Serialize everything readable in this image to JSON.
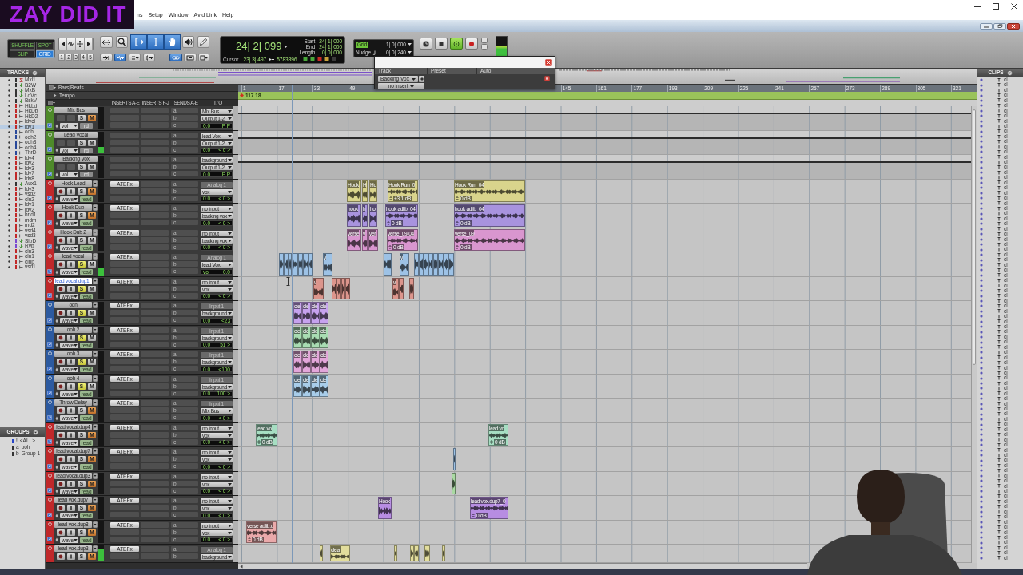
{
  "logo": {
    "text": "ZAY DID IT"
  },
  "menu": [
    {
      "label": "ns"
    },
    {
      "label": "Setup"
    },
    {
      "label": "Window"
    },
    {
      "label": "Avid Link"
    },
    {
      "label": "Help"
    }
  ],
  "toolbar": {
    "edit_modes": [
      {
        "label": "SHUFFLE",
        "selected": false
      },
      {
        "label": "SPOT",
        "selected": false
      },
      {
        "label": "SLIP",
        "selected": false
      },
      {
        "label": "GRID",
        "selected": true
      }
    ],
    "zoom_presets": [
      "1",
      "2",
      "3",
      "4",
      "5"
    ],
    "tools": [
      {
        "kind": "zoom-toggle",
        "selected": false
      },
      {
        "kind": "zoomer",
        "selected": false
      },
      {
        "kind": "trim",
        "selected": true
      },
      {
        "kind": "selector",
        "selected": true
      },
      {
        "kind": "grabber",
        "selected": true
      },
      {
        "kind": "scrub",
        "selected": false
      },
      {
        "kind": "pencil",
        "selected": false
      }
    ],
    "options": [
      {
        "kind": "arrow-bar",
        "selected": false
      },
      {
        "kind": "wave-arrow",
        "selected": true
      },
      {
        "kind": "lines-arrow",
        "selected": false
      },
      {
        "kind": "bracket-arrow",
        "selected": false
      },
      {
        "kind": "link",
        "selected": true
      },
      {
        "kind": "link-box",
        "selected": false
      },
      {
        "kind": "box-arrow",
        "selected": false
      }
    ],
    "counter": {
      "main": "24| 2| 099",
      "start_label": "Start",
      "start": "24| 1| 000",
      "end_label": "End",
      "end": "24| 1| 000",
      "length_label": "Length",
      "length": "0| 0| 000",
      "cursor_label": "Cursor",
      "cursor": "23| 3| 497",
      "sample": "5783896"
    },
    "indicators": [
      {
        "color": "#49a83a"
      },
      {
        "color": "#49a83a"
      },
      {
        "color": "#c92a24"
      },
      {
        "color": "#c9a23a"
      },
      {
        "color": "#3a3a3a"
      }
    ],
    "grid": {
      "label": "Grid",
      "on": true,
      "value": "1| 0| 000"
    },
    "nudge": {
      "label": "Nudge",
      "value": "0| 0| 240"
    },
    "transport": [
      {
        "kind": "online",
        "on": false
      },
      {
        "kind": "stop",
        "on": false
      },
      {
        "kind": "loop-play",
        "on": true
      },
      {
        "kind": "record",
        "on": false
      },
      {
        "kind": "mini",
        "on": false
      },
      {
        "kind": "mini",
        "on": false
      }
    ],
    "meter": {
      "level": 0.55
    }
  },
  "popup": {
    "columns": [
      {
        "label": "Track"
      },
      {
        "label": "Preset"
      },
      {
        "label": "Auto"
      }
    ],
    "track": "Backing Vox",
    "insert": "no insert"
  },
  "tracks_panel": {
    "title": "TRACKS",
    "items": [
      {
        "name": "Mxl1",
        "kind": "master",
        "color": "#333333",
        "selected": false
      },
      {
        "name": "B2W",
        "kind": "aux",
        "color": "#333333",
        "selected": false
      },
      {
        "name": "MxB",
        "kind": "aux",
        "color": "#333333",
        "selected": false
      },
      {
        "name": "LdVc",
        "kind": "aux",
        "color": "#333333",
        "selected": false
      },
      {
        "name": "BskV",
        "kind": "aux",
        "color": "#333333",
        "selected": false
      },
      {
        "name": "HkLd",
        "kind": "audio",
        "color": "#c02828",
        "selected": false
      },
      {
        "name": "HkDb",
        "kind": "audio",
        "color": "#c02828",
        "selected": false
      },
      {
        "name": "HkD2",
        "kind": "audio",
        "color": "#c02828",
        "selected": false
      },
      {
        "name": "ldvcl",
        "kind": "audio",
        "color": "#c02828",
        "selected": false
      },
      {
        "name": "ldv1",
        "kind": "audio",
        "color": "#c02828",
        "selected": true
      },
      {
        "name": "ooh",
        "kind": "audio",
        "color": "#28489a",
        "selected": false
      },
      {
        "name": "ooh2",
        "kind": "audio",
        "color": "#28489a",
        "selected": false
      },
      {
        "name": "ooh3",
        "kind": "audio",
        "color": "#28489a",
        "selected": false
      },
      {
        "name": "ooh4",
        "kind": "audio",
        "color": "#28489a",
        "selected": false
      },
      {
        "name": "ThrD",
        "kind": "audio",
        "color": "#28489a",
        "selected": false
      },
      {
        "name": "ldv4",
        "kind": "audio",
        "color": "#c02828",
        "selected": false
      },
      {
        "name": "ldv2",
        "kind": "audio",
        "color": "#c02828",
        "selected": false
      },
      {
        "name": "ldv3",
        "kind": "audio",
        "color": "#c02828",
        "selected": false
      },
      {
        "name": "ldv7",
        "kind": "audio",
        "color": "#c02828",
        "selected": false
      },
      {
        "name": "ldv8",
        "kind": "audio",
        "color": "#c02828",
        "selected": false
      },
      {
        "name": "Aux1",
        "kind": "aux",
        "color": "#333333",
        "selected": false
      },
      {
        "name": "ldv3",
        "kind": "audio",
        "color": "#c02828",
        "selected": false
      },
      {
        "name": "vsd2",
        "kind": "audio",
        "color": "#c02828",
        "selected": false
      },
      {
        "name": "cln2",
        "kind": "audio",
        "color": "#c02828",
        "selected": false
      },
      {
        "name": "ldv1",
        "kind": "audio",
        "color": "#c02828",
        "selected": false
      },
      {
        "name": "ldv2",
        "kind": "audio",
        "color": "#c02828",
        "selected": false
      },
      {
        "name": "hrld1",
        "kind": "audio",
        "color": "#c02828",
        "selected": false
      },
      {
        "name": "mdm",
        "kind": "audio",
        "color": "#c02828",
        "selected": false
      },
      {
        "name": "md2",
        "kind": "audio",
        "color": "#c02828",
        "selected": false
      },
      {
        "name": "vsd4",
        "kind": "audio",
        "color": "#c02828",
        "selected": false
      },
      {
        "name": "vsd3",
        "kind": "audio",
        "color": "#c02828",
        "selected": false
      },
      {
        "name": "SlpD",
        "kind": "aux",
        "color": "#7a4ad0",
        "selected": false
      },
      {
        "name": "Rvb",
        "kind": "aux",
        "color": "#7a4ad0",
        "selected": false
      },
      {
        "name": "cln3",
        "kind": "audio",
        "color": "#c02828",
        "selected": false
      },
      {
        "name": "cln1",
        "kind": "audio",
        "color": "#c02828",
        "selected": false
      },
      {
        "name": "clnp",
        "kind": "audio",
        "color": "#c02828",
        "selected": false
      },
      {
        "name": "vsd1",
        "kind": "audio",
        "color": "#c02828",
        "selected": false
      }
    ]
  },
  "groups_panel": {
    "title": "GROUPS",
    "items": [
      {
        "letter": "!",
        "name": "<ALL>",
        "color": "#2846c8"
      },
      {
        "letter": "a",
        "name": "ooh",
        "color": "#333333"
      },
      {
        "letter": "b",
        "name": "Group 1",
        "color": "#333333"
      }
    ]
  },
  "ruler": {
    "label": "Bars|Beats",
    "marks": [
      "1",
      "17",
      "33",
      "49",
      "145",
      "161",
      "177",
      "193",
      "209",
      "225",
      "241",
      "257",
      "273",
      "289",
      "305",
      "321"
    ]
  },
  "tempo": {
    "label": "Tempo",
    "value": "117.18"
  },
  "mix_columns": [
    "INSERTS A-E",
    "INSERTS F-J",
    "SENDS A-E",
    "I / O"
  ],
  "tracks": [
    {
      "name": "Mix Bus",
      "color": "#4e8a2a",
      "kind": "aux",
      "editing": false,
      "solo": "S",
      "mute": "M",
      "soloed": false,
      "muted": true,
      "view": "vol",
      "automation": "rd",
      "level": 0,
      "sends": [
        "a",
        "b",
        "c"
      ],
      "input": {
        "label": "Mix Bus",
        "disabled": false
      },
      "output": "Output 1-2",
      "volume": "0.0",
      "pan": "P P"
    },
    {
      "name": "Lead Vocal",
      "color": "#4e8a2a",
      "kind": "aux",
      "editing": false,
      "solo": "S",
      "mute": "M",
      "soloed": false,
      "muted": false,
      "view": "vol",
      "automation": "rd",
      "level": 0.3,
      "sends": [
        "a",
        "b",
        "c"
      ],
      "input": {
        "label": "lead Vox",
        "disabled": false
      },
      "output": "Output 1-2",
      "volume": "0.0",
      "pan": "< 0 >"
    },
    {
      "name": "Backing Vox",
      "color": "#4e8a2a",
      "kind": "aux",
      "editing": false,
      "solo": "S",
      "mute": "M",
      "soloed": false,
      "muted": false,
      "view": "vol",
      "automation": "rd",
      "level": 0,
      "sends": [
        "a",
        "b",
        "c"
      ],
      "input": {
        "label": "background",
        "disabled": false
      },
      "output": "Output 1-2",
      "volume": "0.0",
      "pan": "P P"
    },
    {
      "name": "Hook Lead",
      "color": "#c0282a",
      "kind": "audio",
      "editing": false,
      "solo": "S",
      "mute": "M",
      "soloed": false,
      "muted": true,
      "view": "wave",
      "automation": "read",
      "level": 0,
      "inserts": [
        "ATEFx"
      ],
      "sends": [
        "a",
        "b",
        "c"
      ],
      "input": {
        "label": "Analog 1",
        "disabled": true
      },
      "output": "vox",
      "volume": "0.0",
      "pan": "< 0 >",
      "clips": [
        {
          "name": "Hook",
          "color": "#d9d48c"
        },
        {
          "name": "H",
          "color": "#d9d48c"
        },
        {
          "name": "Ho",
          "color": "#d9d48c"
        },
        {
          "name": "Hook Run_0",
          "color": "#d9d48c",
          "gain": "+3.1 dB"
        },
        {
          "name": "Hook Run_04",
          "color": "#d9d48c",
          "gain": "0 dB"
        }
      ]
    },
    {
      "name": "Hook Dub",
      "color": "#c0282a",
      "kind": "audio",
      "editing": false,
      "solo": "S",
      "mute": "M",
      "soloed": false,
      "muted": true,
      "view": "wave",
      "automation": "read",
      "level": 0,
      "inserts": [
        "ATEFx"
      ],
      "sends": [
        "a",
        "b",
        "c"
      ],
      "input": {
        "label": "no input",
        "disabled": false
      },
      "output": "backing vox",
      "volume": "0.0",
      "pan": "< 0 >",
      "clips": [
        {
          "name": "hook",
          "color": "#a893de"
        },
        {
          "name": "h",
          "color": "#a893de"
        },
        {
          "name": "ho",
          "color": "#a893de"
        },
        {
          "name": "hook adlib_04",
          "color": "#a893de",
          "gain": "0 dB"
        },
        {
          "name": "hook adlib_04",
          "color": "#a893de",
          "gain": "0 dB"
        }
      ]
    },
    {
      "name": "Hook Dub 2",
      "color": "#c0282a",
      "kind": "audio",
      "editing": false,
      "solo": "S",
      "mute": "M",
      "soloed": false,
      "muted": false,
      "view": "wave",
      "automation": "read",
      "level": 0,
      "inserts": [
        "ATEFx"
      ],
      "sends": [
        "a",
        "b",
        "c"
      ],
      "input": {
        "label": "no input",
        "disabled": false
      },
      "output": "backing vox",
      "volume": "0.0",
      "pan": "< 0 >",
      "clips": [
        {
          "name": "verse",
          "color": "#d996cf"
        },
        {
          "name": "v",
          "color": "#d996cf"
        },
        {
          "name": "ver",
          "color": "#d996cf"
        },
        {
          "name": "verse_09-04",
          "color": "#d996cf",
          "gain": "0 dB"
        },
        {
          "name": "verse_09",
          "color": "#d996cf",
          "gain": "0 dB"
        }
      ]
    },
    {
      "name": "lead vocal",
      "color": "#c0282a",
      "kind": "audio",
      "editing": false,
      "solo": "S",
      "mute": "M",
      "soloed": true,
      "muted": false,
      "view": "wave",
      "automation": "read",
      "level": 0.3,
      "inserts": [
        "ATEFx"
      ],
      "sends": [
        "a",
        "b",
        "c"
      ],
      "input": {
        "label": "Analog 1",
        "disabled": true
      },
      "output": "lead Vox",
      "vol_label": "vol",
      "volume": "0.0",
      "clips": [
        {
          "color": "#9dc2e6"
        },
        {
          "color": "#9dc2e6"
        },
        {
          "color": "#9dc2e6"
        },
        {
          "color": "#9dc2e6"
        },
        {
          "color": "#9dc2e6"
        },
        {
          "color": "#9dc2e6"
        },
        {
          "color": "#9dc2e6"
        },
        {
          "name": "v",
          "color": "#9dc2e6"
        },
        {
          "color": "#9dc2e6"
        },
        {
          "name": "v",
          "color": "#9dc2e6"
        },
        {
          "color": "#9dc2e6"
        },
        {
          "color": "#9dc2e6"
        },
        {
          "color": "#9dc2e6"
        },
        {
          "color": "#9dc2e6"
        },
        {
          "color": "#9dc2e6"
        },
        {
          "color": "#9dc2e6"
        },
        {
          "color": "#9dc2e6"
        },
        {
          "color": "#9dc2e6"
        }
      ]
    },
    {
      "name": "lead vocal.dup1",
      "color": "#c0282a",
      "kind": "audio",
      "editing": true,
      "solo": "S",
      "mute": "M",
      "soloed": true,
      "muted": false,
      "view": "wave",
      "automation": "read",
      "level": 0,
      "inserts": [
        "ATEFx"
      ],
      "sends": [
        "a",
        "b",
        "c"
      ],
      "input": {
        "label": "no input",
        "disabled": false
      },
      "output": "vox",
      "volume": "0.0",
      "pan": "< 0 >",
      "clips": [
        {
          "name": "v",
          "color": "#dc958c"
        },
        {
          "color": "#dc958c"
        },
        {
          "color": "#dc958c"
        },
        {
          "color": "#dc958c"
        },
        {
          "color": "#dc958c"
        },
        {
          "name": "v",
          "color": "#dc958c"
        },
        {
          "color": "#dc958c"
        },
        {
          "color": "#dc958c"
        }
      ]
    },
    {
      "name": "ooh",
      "color": "#2c5aa0",
      "kind": "audio",
      "editing": false,
      "solo": "S",
      "mute": "M",
      "soloed": true,
      "muted": false,
      "view": "wave",
      "automation": "read",
      "level": 0,
      "inserts": [
        "ATEFx"
      ],
      "sends": [
        "a",
        "b",
        "c"
      ],
      "input": {
        "label": "Input 1",
        "disabled": true
      },
      "output": "background",
      "volume": "0.0",
      "pan": "<23",
      "clips": [
        {
          "name": "cle",
          "color": "#c6a2ee"
        },
        {
          "name": "cle",
          "color": "#c6a2ee"
        },
        {
          "name": "cle",
          "color": "#c6a2ee"
        },
        {
          "name": "cle",
          "color": "#c6a2ee"
        }
      ]
    },
    {
      "name": "ooh 2",
      "color": "#2c5aa0",
      "kind": "audio",
      "editing": false,
      "solo": "S",
      "mute": "M",
      "soloed": true,
      "muted": false,
      "view": "wave",
      "automation": "read",
      "level": 0,
      "inserts": [
        "ATEFx"
      ],
      "sends": [
        "a",
        "b",
        "c"
      ],
      "input": {
        "label": "Input 1",
        "disabled": true
      },
      "output": "background",
      "volume": "0.0",
      "pan": "51 >",
      "clips": [
        {
          "name": "cle",
          "color": "#a8dcb2"
        },
        {
          "name": "cle",
          "color": "#a8dcb2"
        },
        {
          "name": "cle",
          "color": "#a8dcb2"
        },
        {
          "name": "cle",
          "color": "#a8dcb2"
        }
      ]
    },
    {
      "name": "ooh 3",
      "color": "#2c5aa0",
      "kind": "audio",
      "editing": false,
      "solo": "S",
      "mute": "M",
      "soloed": true,
      "muted": false,
      "view": "wave",
      "automation": "read",
      "level": 0,
      "inserts": [
        "ATEFx"
      ],
      "sends": [
        "a",
        "b",
        "c"
      ],
      "input": {
        "label": "Input 1",
        "disabled": true
      },
      "output": "background",
      "volume": "0.0",
      "pan": "<100",
      "clips": [
        {
          "name": "cle",
          "color": "#e3a6da"
        },
        {
          "name": "cle",
          "color": "#e3a6da"
        },
        {
          "name": "cle",
          "color": "#e3a6da"
        },
        {
          "name": "cle",
          "color": "#e3a6da"
        }
      ]
    },
    {
      "name": "ooh 4",
      "color": "#2c5aa0",
      "kind": "audio",
      "editing": false,
      "solo": "S",
      "mute": "M",
      "soloed": true,
      "muted": false,
      "view": "wave",
      "automation": "read",
      "level": 0,
      "inserts": [
        "ATEFx"
      ],
      "sends": [
        "a",
        "b",
        "c"
      ],
      "input": {
        "label": "Input 1",
        "disabled": true
      },
      "output": "background",
      "volume": "0.0",
      "pan": "100 >",
      "clips": [
        {
          "name": "cle",
          "color": "#a8cdea"
        },
        {
          "name": "cle",
          "color": "#a8cdea"
        },
        {
          "name": "cle",
          "color": "#a8cdea"
        },
        {
          "name": "cle",
          "color": "#a8cdea"
        }
      ]
    },
    {
      "name": "Throw Delay",
      "color": "#2c5aa0",
      "kind": "audio",
      "editing": false,
      "solo": "S",
      "mute": "M",
      "soloed": false,
      "muted": true,
      "view": "wave",
      "automation": "read",
      "level": 0,
      "inserts": [
        "ATEFx"
      ],
      "sends": [
        "a",
        "b",
        "c"
      ],
      "input": {
        "label": "Input 1",
        "disabled": true
      },
      "output": "Mix Bus",
      "volume": "0.0",
      "pan": "< 0 >"
    },
    {
      "name": "lead vocal.dup4",
      "color": "#c0282a",
      "kind": "audio",
      "editing": false,
      "solo": "S",
      "mute": "M",
      "soloed": false,
      "muted": true,
      "view": "wave",
      "automation": "read",
      "level": 0,
      "inserts": [
        "ATEFx"
      ],
      "sends": [
        "a",
        "b",
        "c"
      ],
      "input": {
        "label": "no input",
        "disabled": false
      },
      "output": "vox",
      "volume": "0.0",
      "pan": "< 0 >",
      "clips": [
        {
          "name": "lead vo",
          "color": "#a6dec2",
          "gain": "0 dB"
        },
        {
          "name": "lead vo",
          "color": "#a6dec2",
          "gain": "0 dB"
        }
      ]
    },
    {
      "name": "lead vocal.dup7",
      "color": "#c0282a",
      "kind": "audio",
      "editing": false,
      "solo": "S",
      "mute": "M",
      "soloed": false,
      "muted": true,
      "view": "wave",
      "automation": "read",
      "level": 0,
      "inserts": [
        "ATEFx"
      ],
      "sends": [
        "a",
        "b",
        "c"
      ],
      "input": {
        "label": "no input",
        "disabled": false
      },
      "output": "vox",
      "volume": "0.0",
      "pan": "< 0 >",
      "clips": [
        {
          "color": "#9dc2e6"
        }
      ]
    },
    {
      "name": "lead vocal.dup3",
      "color": "#c0282a",
      "kind": "audio",
      "editing": false,
      "solo": "S",
      "mute": "M",
      "soloed": false,
      "muted": true,
      "view": "wave",
      "automation": "read",
      "level": 0,
      "inserts": [
        "ATEFx"
      ],
      "sends": [
        "a",
        "b",
        "c"
      ],
      "input": {
        "label": "no input",
        "disabled": false
      },
      "output": "vox",
      "volume": "0.0",
      "pan": "< 0 >",
      "clips": [
        {
          "color": "#a9d9a2"
        }
      ]
    },
    {
      "name": "lead vox.dup7",
      "color": "#c0282a",
      "kind": "audio",
      "editing": false,
      "solo": "S",
      "mute": "M",
      "soloed": false,
      "muted": true,
      "view": "wave",
      "automation": "read",
      "level": 0,
      "inserts": [
        "ATEFx"
      ],
      "sends": [
        "a",
        "b",
        "c"
      ],
      "input": {
        "label": "no input",
        "disabled": false
      },
      "output": "vox",
      "volume": "0.0",
      "pan": "< 0 >",
      "clips": [
        {
          "name": "Hook",
          "color": "#b78de2"
        },
        {
          "name": "lead vox.dup7_0",
          "color": "#b78de2",
          "gain": "0 dB"
        }
      ]
    },
    {
      "name": "lead vox.dup8",
      "color": "#c0282a",
      "kind": "audio",
      "editing": false,
      "solo": "S",
      "mute": "M",
      "soloed": false,
      "muted": true,
      "view": "wave",
      "automation": "read",
      "level": 0,
      "inserts": [
        "ATEFx"
      ],
      "sends": [
        "a",
        "b",
        "c"
      ],
      "input": {
        "label": "no input",
        "disabled": false
      },
      "output": "vox",
      "volume": "0.0",
      "pan": "< 0 >",
      "clips": [
        {
          "name": "verse adlib.d",
          "color": "#eaa9aa",
          "gain": "0 dB"
        }
      ]
    },
    {
      "name": "lead vox.dup3",
      "color": "#c0282a",
      "kind": "audio",
      "editing": false,
      "solo": "S",
      "mute": "M",
      "soloed": false,
      "muted": true,
      "level": 0.8,
      "inserts": [
        "ATEFx"
      ],
      "sends": [
        "a",
        "b"
      ],
      "input": {
        "label": "Analog 1",
        "disabled": true
      },
      "output": "background",
      "clips": [
        {
          "color": "#e2dd9c"
        },
        {
          "name": "clear",
          "color": "#e2dd9c"
        },
        {
          "color": "#e2dd9c"
        },
        {
          "color": "#e2dd9c"
        },
        {
          "color": "#e2dd9c"
        },
        {
          "color": "#e2dd9c"
        },
        {
          "color": "#e2dd9c"
        }
      ]
    }
  ],
  "clips_panel": {
    "title": "CLIPS",
    "items": [
      "cl",
      "cl",
      "cl",
      "cl",
      "cl",
      "cl",
      "cl",
      "cl",
      "cl",
      "cl",
      "cl",
      "cl",
      "cl",
      "cl",
      "cl",
      "cl",
      "cl",
      "cl",
      "cl",
      "cl",
      "cl",
      "cl",
      "cl",
      "cl",
      "cl",
      "cl",
      "cl",
      "cl",
      "cl",
      "cl",
      "cl",
      "cl",
      "cl",
      "cl",
      "cl",
      "cl",
      "cl",
      "cl",
      "cl",
      "cl",
      "cl",
      "cl",
      "cl",
      "cl",
      "cl",
      "cl",
      "cl",
      "cl",
      "cl",
      "cl",
      "cl",
      "cl",
      "cl",
      "cl",
      "cl",
      "cl",
      "cl",
      "cl",
      "cl",
      "cl",
      "cl",
      "cl",
      "cl",
      "cl",
      "cl",
      "cl",
      "cl",
      "cl",
      "cl",
      "cl",
      "cl",
      "cl",
      "cl",
      "cl",
      "cl",
      "cl",
      "cl",
      "cl",
      "cl",
      "cl",
      "cl",
      "cl",
      "cl",
      "cl",
      "cl",
      "cl",
      "cl",
      "cl",
      "cl",
      "cl",
      "cl",
      "cl",
      "cl",
      "cl"
    ]
  }
}
